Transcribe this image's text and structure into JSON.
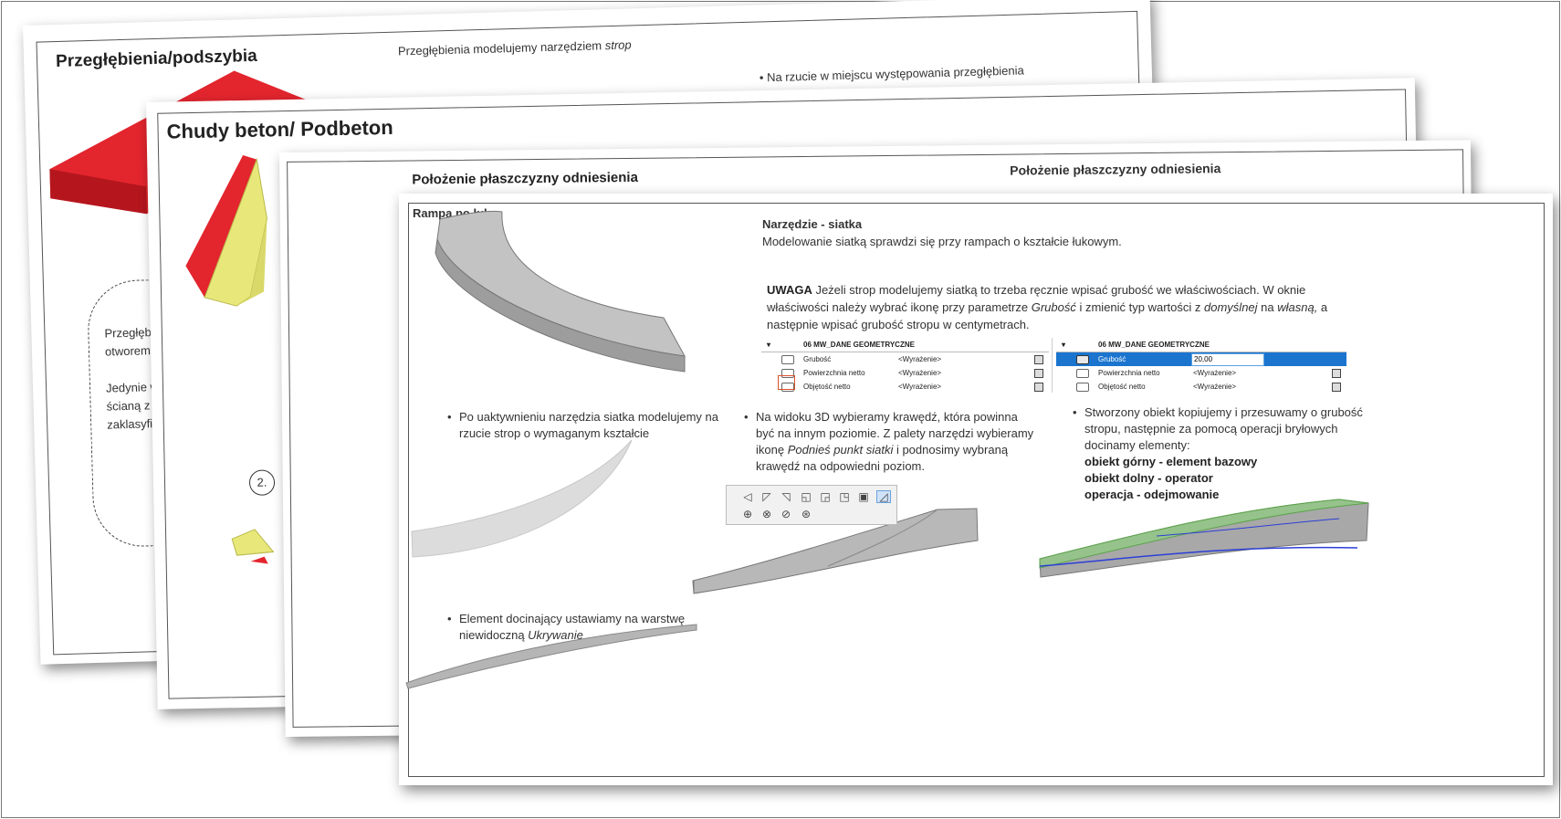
{
  "slide1": {
    "title": "Przegłębienia/podszybia",
    "subtitle_prefix": "Przegłębienia modelujemy narzędziem ",
    "subtitle_tool": "strop",
    "bullet_top": "•  Na rzucie w miejscu występowania przegłębienia",
    "left_text": [
      "Przegłębieni",
      "otworem, ni",
      "Jedynie w pr",
      "ścianą z fun",
      "zaklasyfikow"
    ]
  },
  "slide2": {
    "title": "Chudy beton/ Podbeton",
    "step_number": "2."
  },
  "slide3": {
    "title": "Położenie płaszczyzny odniesienia",
    "right_heading": "Położenie płaszczyzny odniesienia"
  },
  "slide4": {
    "title": "Rampa po łuku",
    "tool_title": "Narzędzie - siatka",
    "tool_desc": "Modelowanie siatką sprawdzi się przy rampach o kształcie łukowym.",
    "warning_label": "UWAGA",
    "warning_text_1": " Jeżeli strop modelujemy siatką to trzeba ręcznie wpisać grubość we właściwościach. W oknie właściwości należy wybrać ikonę przy parametrze ",
    "warning_em_1": "Grubość",
    "warning_text_2": " i zmienić typ wartości z ",
    "warning_em_2": "domyślnej",
    "warning_text_3": " na ",
    "warning_em_3": "własną,",
    "warning_text_4": " a następnie wpisać grubość stropu w centymetrach.",
    "prop_table_left": {
      "header": "06 MW_DANE GEOMETRYCZNE",
      "rows": [
        {
          "label": "Grubość",
          "value": "<Wyrażenie>"
        },
        {
          "label": "Powierzchnia netto",
          "value": "<Wyrażenie>"
        },
        {
          "label": "Objętość netto",
          "value": "<Wyrażenie>"
        }
      ]
    },
    "prop_table_right": {
      "header": "06 MW_DANE GEOMETRYCZNE",
      "rows": [
        {
          "label": "Grubość",
          "value": "20,00"
        },
        {
          "label": "Powierzchnia netto",
          "value": "<Wyrażenie>"
        },
        {
          "label": "Objętość netto",
          "value": "<Wyrażenie>"
        }
      ]
    },
    "bullet_1": "Po uaktywnieniu narzędzia siatka modelujemy na rzucie strop o wymaganym kształcie",
    "bullet_2_a": "Na widoku 3D wybieramy krawędź, która powinna być na innym poziomie. Z palety narzędzi wybieramy ikonę ",
    "bullet_2_em": "Podnieś punkt siatki",
    "bullet_2_b": " i podnosimy wybraną krawędź na odpowiedni poziom.",
    "bullet_3": "Stworzony obiekt kopiujemy i przesuwamy o grubość stropu, następnie za pomocą operacji bryłowych docinamy elementy:",
    "bullet_3_l1": "obiekt górny - element bazowy",
    "bullet_3_l2": "obiekt dolny - operator",
    "bullet_3_l3": "operacja - odejmowanie",
    "bullet_4_a": "Element docinający ustawiamy na warstwę niewidoczną ",
    "bullet_4_em": "Ukrywanie",
    "toolbar_icons": [
      "adjust-elevation-icon",
      "curve-edge-icon",
      "offset-edge-icon",
      "split-icon",
      "corner-icon",
      "rotate-icon",
      "add-point-icon",
      "raise-point-icon",
      "insert-node-icon",
      "mesh-edit-icon",
      "merge-icon",
      "explode-icon"
    ]
  },
  "colors": {
    "red": "#e3252e",
    "yellow": "#e8e87a",
    "mesh_grey": "#b9b9b9",
    "selection_blue": "#1b75cf",
    "green_overlay": "#8fce7f"
  }
}
